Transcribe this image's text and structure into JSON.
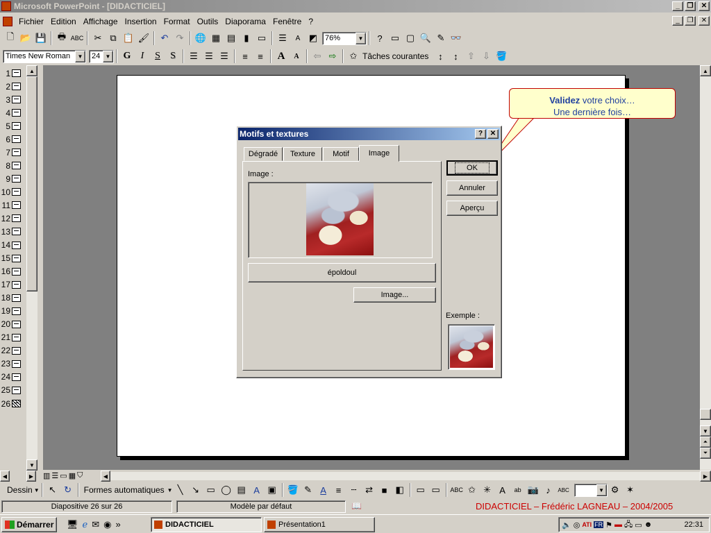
{
  "window": {
    "title": "Microsoft PowerPoint - [DIDACTICIEL]"
  },
  "menu": {
    "items": [
      "Fichier",
      "Edition",
      "Affichage",
      "Insertion",
      "Format",
      "Outils",
      "Diaporama",
      "Fenêtre",
      "?"
    ]
  },
  "toolbar": {
    "zoom": "76%",
    "font_name": "Times New Roman",
    "font_size": "24",
    "bold": "G",
    "italic": "I",
    "underline": "S",
    "shadow": "S",
    "tasks_label": "Tâches courantes"
  },
  "outline": {
    "rows": [
      "1",
      "2",
      "3",
      "4",
      "5",
      "6",
      "7",
      "8",
      "9",
      "10",
      "11",
      "12",
      "13",
      "14",
      "15",
      "16",
      "17",
      "18",
      "19",
      "20",
      "21",
      "22",
      "23",
      "24",
      "25",
      "26"
    ]
  },
  "callout": {
    "line1_bold": "Validez",
    "line1_rest": " votre choix…",
    "line2": "Une dernière fois…"
  },
  "dialog": {
    "title": "Motifs et textures",
    "tabs": [
      "Dégradé",
      "Texture",
      "Motif",
      "Image"
    ],
    "active_tab": "Image",
    "image_label": "Image :",
    "image_name": "époldoul",
    "image_button": "Image...",
    "ok": "OK",
    "cancel": "Annuler",
    "preview": "Aperçu",
    "example_label": "Exemple :"
  },
  "draw_toolbar": {
    "draw_label": "Dessin",
    "autoshapes_label": "Formes automatiques"
  },
  "statusbar": {
    "slide_info": "Diapositive 26 sur 26",
    "template": "Modèle par défaut",
    "credit": "DIDACTICIEL – Frédéric LAGNEAU – 2004/2005"
  },
  "taskbar": {
    "start": "Démarrer",
    "tasks": [
      "DIDACTICIEL",
      "Présentation1"
    ],
    "clock": "22:31",
    "lang": "FR"
  },
  "colors": {
    "accent_title": "#0a246a",
    "callout_border": "#c00000",
    "callout_text": "#1f3f9f",
    "credit_text": "#cc0000"
  }
}
